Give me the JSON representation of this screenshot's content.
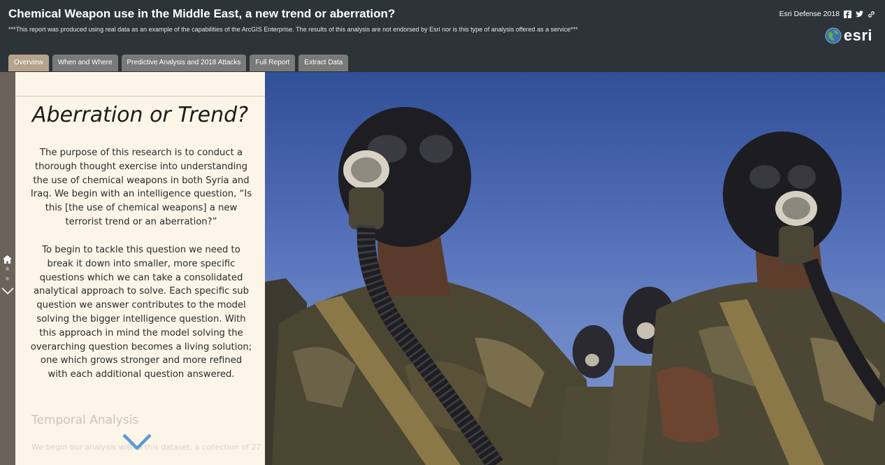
{
  "header": {
    "title": "Chemical Weapon use in the Middle East, a new trend or aberration?",
    "subtitle": "***This report was produced using real data as an example of the capabilities of the ArcGIS Enterprise. The results of this analysis are not endorsed by Esri nor is this type of analysis offered as a service***",
    "brand_label": "Esri Defense 2018",
    "logo_text": "esri",
    "social_icons": [
      "facebook-icon",
      "twitter-icon",
      "link-icon"
    ]
  },
  "tabs": [
    {
      "label": "Overview",
      "active": true
    },
    {
      "label": "When and Where",
      "active": false
    },
    {
      "label": "Predictive Analysis and 2018 Attacks",
      "active": false
    },
    {
      "label": "Full Report",
      "active": false
    },
    {
      "label": "Extract Data",
      "active": false
    }
  ],
  "panel": {
    "heading": "Aberration or Trend?",
    "paragraphs": [
      "The purpose of this research is to conduct a thorough thought exercise into understanding the use of chemical weapons in both Syria and Iraq. We begin with an intelligence question, “Is this [the use of chemical weapons] a new terrorist trend or an aberration?”",
      "To begin to tackle this question we need to break it down into smaller, more specific questions which we can take a consolidated analytical approach to solve. Each specific sub question we answer contributes to the model solving the bigger intelligence question. With this approach in mind the model solving the overarching question becomes a living solution; one which grows stronger and more refined with each additional question answered."
    ],
    "next_heading": "Temporal Analysis",
    "next_text": "We begin our analysis with a    this dataset, a collection of 27"
  },
  "colors": {
    "header_bg": "#2d3438",
    "tab_active": "#b5a48b",
    "tab_inactive": "#7a7a7a",
    "panel_bg": "#fdf6e8",
    "rail_bg": "#6b625b",
    "accent_chevron": "#5b9bd5"
  }
}
